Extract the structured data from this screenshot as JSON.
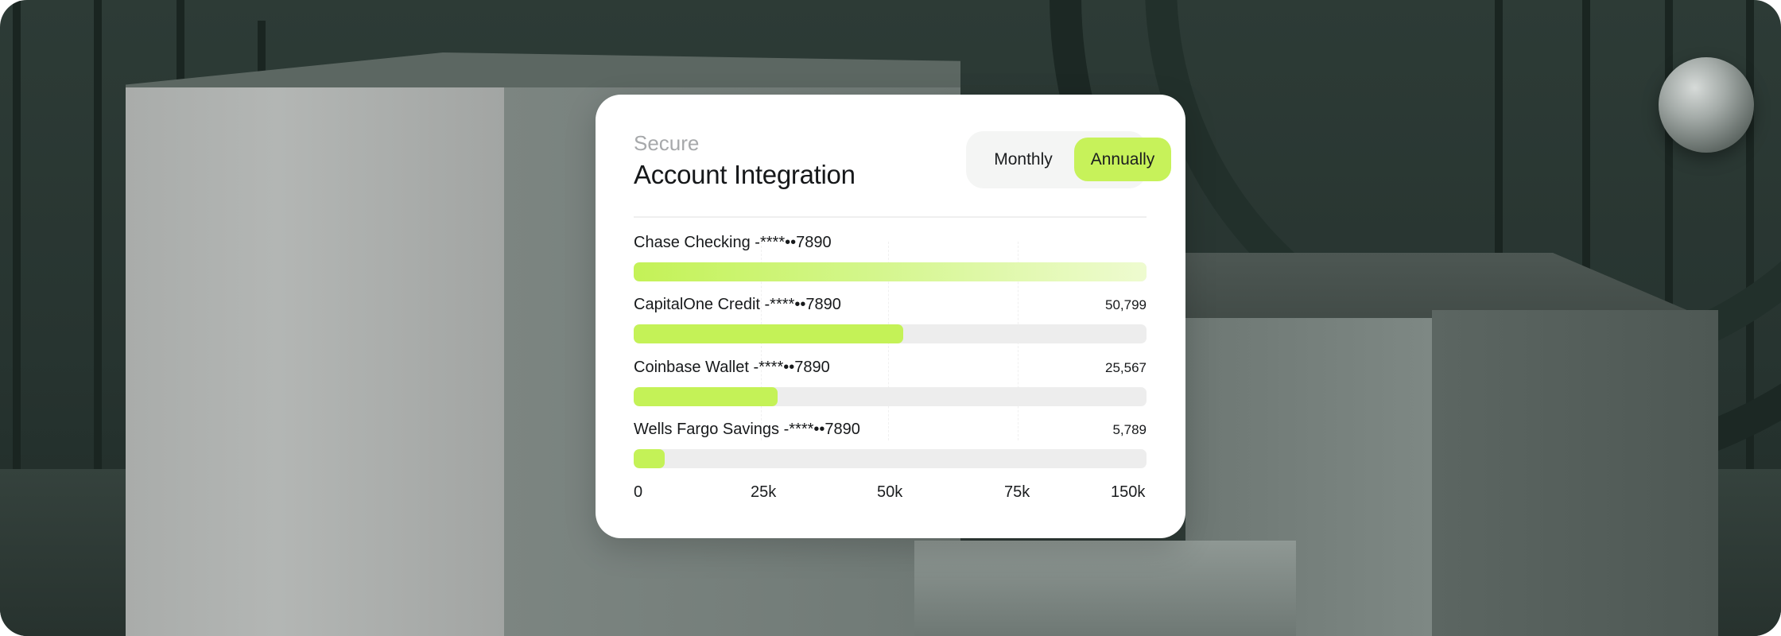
{
  "card": {
    "eyebrow": "Secure",
    "title": "Account Integration",
    "toggle": {
      "options": [
        "Monthly",
        "Annually"
      ],
      "selected": "Annually"
    },
    "accounts": [
      {
        "name": "Chase Checking -****••7890",
        "value": "",
        "level": 1.0
      },
      {
        "name": "CapitalOne Credit -****••7890",
        "value": "50,799",
        "level": 0.525
      },
      {
        "name": "Coinbase Wallet -****••7890",
        "value": "25,567",
        "level": 0.28
      },
      {
        "name": "Wells Fargo Savings -****••7890",
        "value": "5,789",
        "level": 0.06
      }
    ],
    "axis_ticks": [
      "0",
      "25k",
      "50k",
      "75k",
      "150k"
    ]
  },
  "colors": {
    "accent": "#c4f257",
    "card_bg": "#ffffff",
    "scene_bg": "#2d3b36"
  }
}
